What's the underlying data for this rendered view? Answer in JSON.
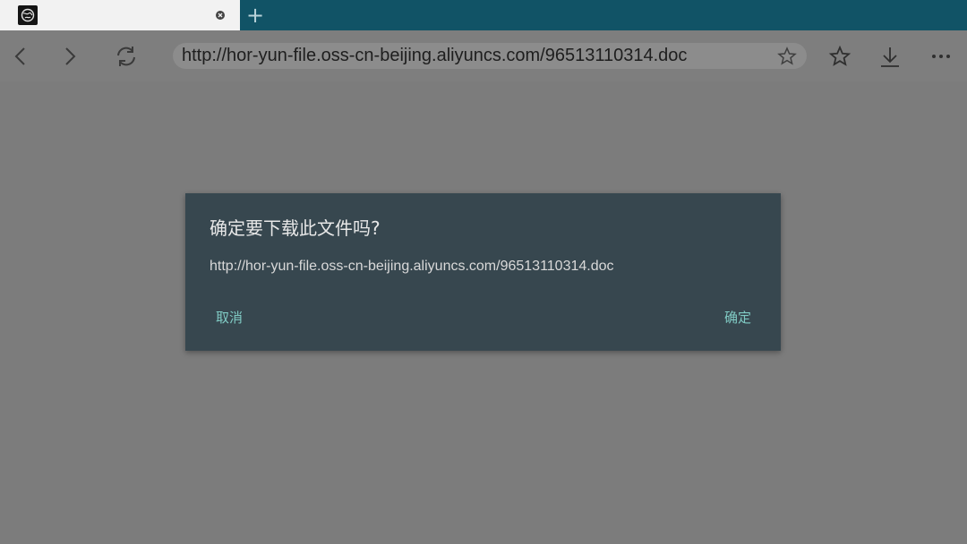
{
  "tab": {
    "favicon": "globe-icon",
    "close": "close-icon",
    "newtab_glyph": "+"
  },
  "toolbar": {
    "back": "back-icon",
    "forward": "forward-icon",
    "reload": "reload-icon",
    "url": "http://hor-yun-file.oss-cn-beijing.aliyuncs.com/96513110314.doc",
    "bookmark_star": "star-outline-icon",
    "favorites": "favorites-star-icon",
    "download": "download-icon",
    "menu": "more-icon"
  },
  "dialog": {
    "title": "确定要下载此文件吗?",
    "message": "http://hor-yun-file.oss-cn-beijing.aliyuncs.com/96513110314.doc",
    "cancel_label": "取消",
    "ok_label": "确定"
  },
  "colors": {
    "tabstrip": "#115366",
    "page_overlay": "#7c7c7c",
    "dialog_bg": "#37474f",
    "dialog_button": "#80cbc4"
  }
}
